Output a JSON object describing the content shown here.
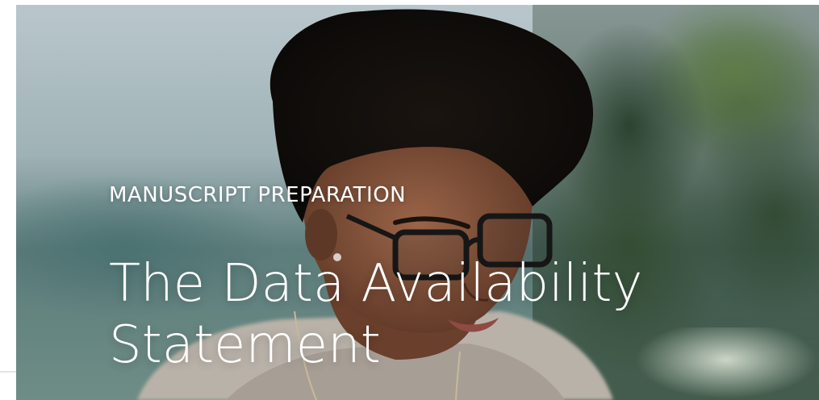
{
  "hero": {
    "eyebrow": "MANUSCRIPT PREPARATION",
    "title": "The Data Availability Statement",
    "image": "woman-reading-with-glasses-photo"
  }
}
